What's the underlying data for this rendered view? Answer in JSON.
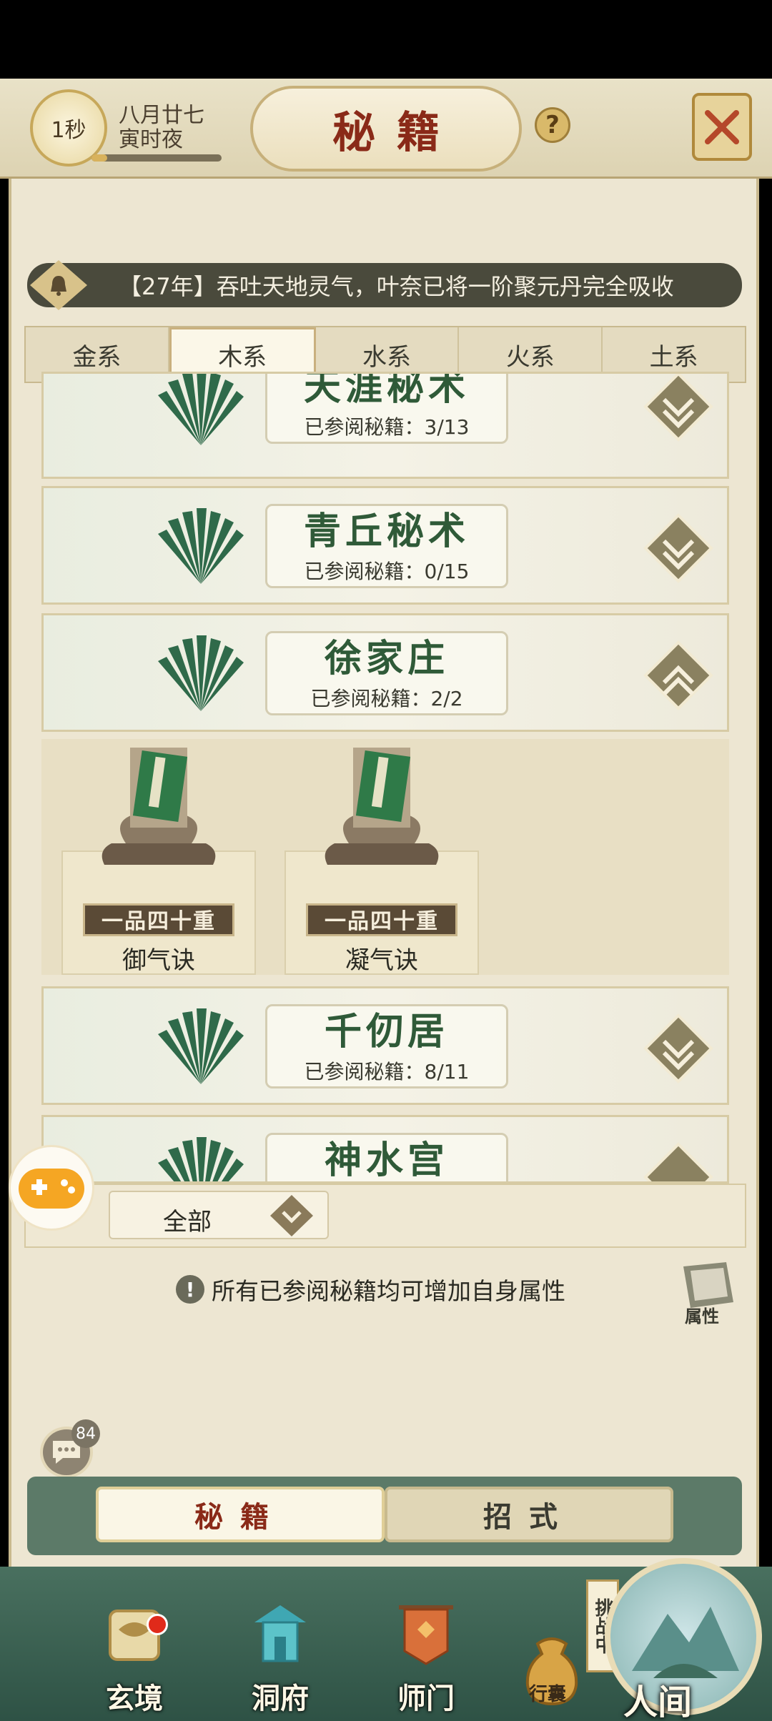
{
  "header": {
    "timer": "1秒",
    "date_line1": "八月廿七",
    "date_line2": "寅时夜",
    "time_progress": 0.12,
    "title": "秘籍",
    "help_label": "?"
  },
  "notice": {
    "text": "【27年】吞吐天地灵气，叶奈已将一阶聚元丹完全吸收"
  },
  "tabs": [
    "金系",
    "木系",
    "水系",
    "火系",
    "土系"
  ],
  "active_tab": "木系",
  "categories": [
    {
      "name": "天涯秘术",
      "count_label": "已参阅秘籍：3/13",
      "expanded": false
    },
    {
      "name": "青丘秘术",
      "count_label": "已参阅秘籍：0/15",
      "expanded": false
    },
    {
      "name": "徐家庄",
      "count_label": "已参阅秘籍：2/2",
      "expanded": true
    },
    {
      "name": "千仞居",
      "count_label": "已参阅秘籍：8/11",
      "expanded": false
    },
    {
      "name": "神水宫",
      "count_label": "",
      "expanded": false
    }
  ],
  "books": [
    {
      "grade": "一品四十重",
      "name": "御气诀"
    },
    {
      "grade": "一品四十重",
      "name": "凝气诀"
    }
  ],
  "filter": {
    "selected": "全部"
  },
  "info": {
    "text": "所有已参阅秘籍均可增加自身属性",
    "icon": "!"
  },
  "attr_button": {
    "label": "属性"
  },
  "chat": {
    "badge": "84"
  },
  "subtabs": [
    "秘籍",
    "招式"
  ],
  "nav": {
    "items": [
      {
        "label": "玄境",
        "icon": "scroll-icon"
      },
      {
        "label": "洞府",
        "icon": "pagoda-icon"
      },
      {
        "label": "师门",
        "icon": "banner-icon"
      }
    ],
    "bag_label": "行囊",
    "battle_tag": "挑战中",
    "renjian_label": "人间"
  },
  "colors": {
    "title": "#8a2a18",
    "category_name": "#2f5a38",
    "nav_bg": "#2e5245"
  }
}
